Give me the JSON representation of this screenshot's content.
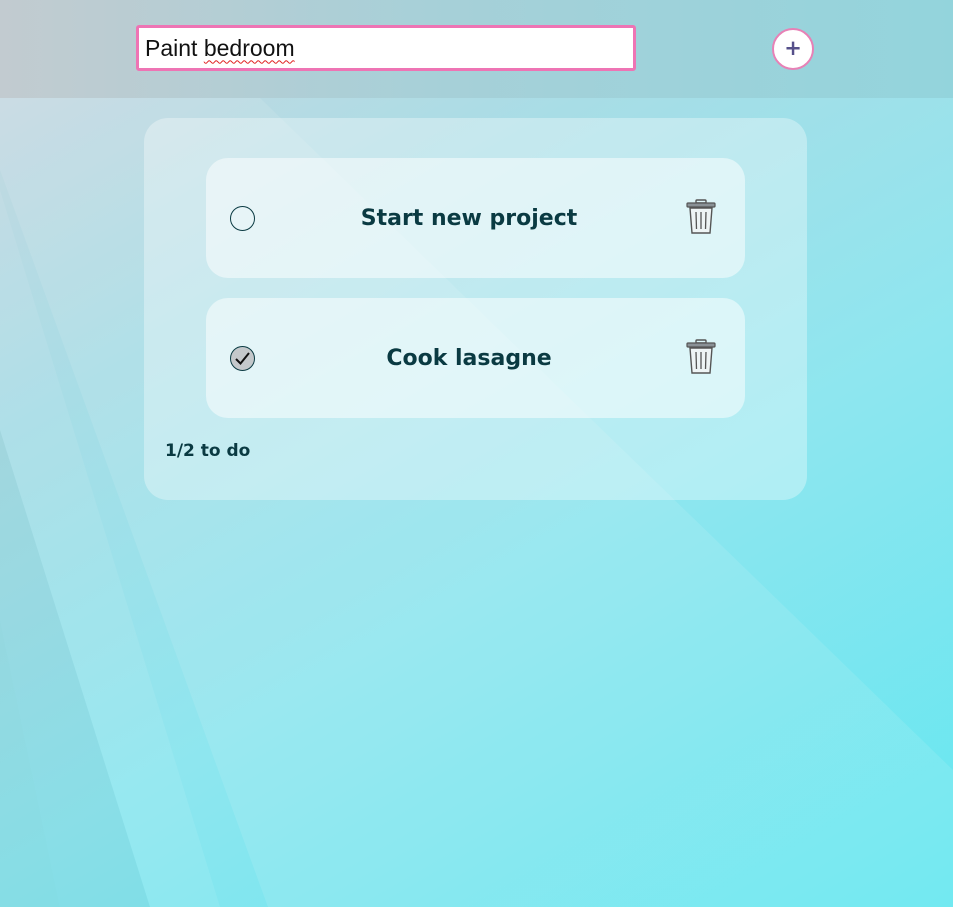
{
  "new_task": {
    "value_word1": "Paint",
    "value_word2": "bedroom",
    "add_button_label": "+"
  },
  "tasks": [
    {
      "title": "Start new project",
      "completed": false
    },
    {
      "title": "Cook lasagne",
      "completed": true
    }
  ],
  "summary": {
    "counter": "1/2 to do"
  },
  "icons": {
    "checkbox_done": "checkmark-icon",
    "delete": "trash-icon"
  },
  "colors": {
    "accent_border": "#ee74b4",
    "text": "#0a3a42",
    "add_button_glyph": "#56508a"
  }
}
